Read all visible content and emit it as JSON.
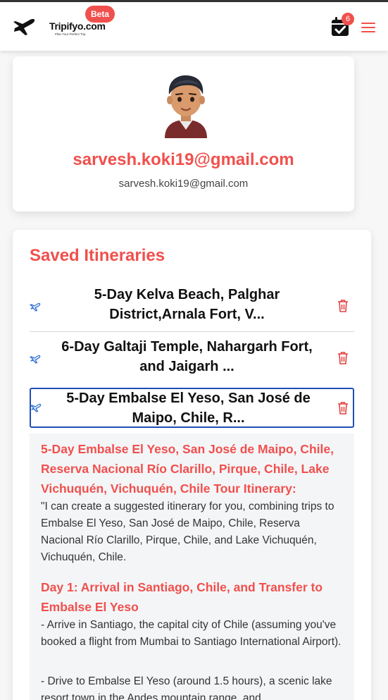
{
  "header": {
    "logo_text": "Tripifyo.com",
    "logo_tagline": "Plan Your Perfect Trip",
    "beta_label": "Beta",
    "calendar_badge_count": "6"
  },
  "profile": {
    "name": "sarvesh.koki19@gmail.com",
    "email": "sarvesh.koki19@gmail.com"
  },
  "itineraries": {
    "heading": "Saved Itineraries",
    "items": [
      {
        "title": "5-Day Kelva Beach, Palghar District,Arnala Fort, V..."
      },
      {
        "title": "6-Day Galtaji Temple, Nahargarh Fort, and Jaigarh ..."
      },
      {
        "title": "5-Day Embalse El Yeso, San José de Maipo, Chile, R..."
      }
    ]
  },
  "detail": {
    "title": "5-Day Embalse El Yeso, San José de Maipo, Chile, Reserva Nacional Río Clarillo, Pirque, Chile, Lake Vichuquén, Vichuquén, Chile Tour Itinerary:",
    "intro": "\"I can create a suggested itinerary for you, combining trips to Embalse El Yeso, San José de Maipo, Chile, Reserva Nacional Río Clarillo, Pirque, Chile, and Lake Vichuquén, Vichuquén, Chile.",
    "day1_heading": "Day 1: Arrival in Santiago, Chile, and Transfer to Embalse El Yeso",
    "day1_p1": "- Arrive in Santiago, the capital city of Chile (assuming you've booked a flight from Mumbai to Santiago International Airport).",
    "day1_p2": "- Drive to Embalse El Yeso (around 1.5 hours), a scenic lake resort town in the Andes mountain range, and"
  },
  "colors": {
    "accent": "#f0504d",
    "selected_border": "#1f4fb5",
    "plane_icon": "#2f6fd6"
  },
  "icons": [
    "airplane-logo-icon",
    "calendar-check-icon",
    "hamburger-menu-icon",
    "airplane-icon",
    "trash-icon"
  ]
}
